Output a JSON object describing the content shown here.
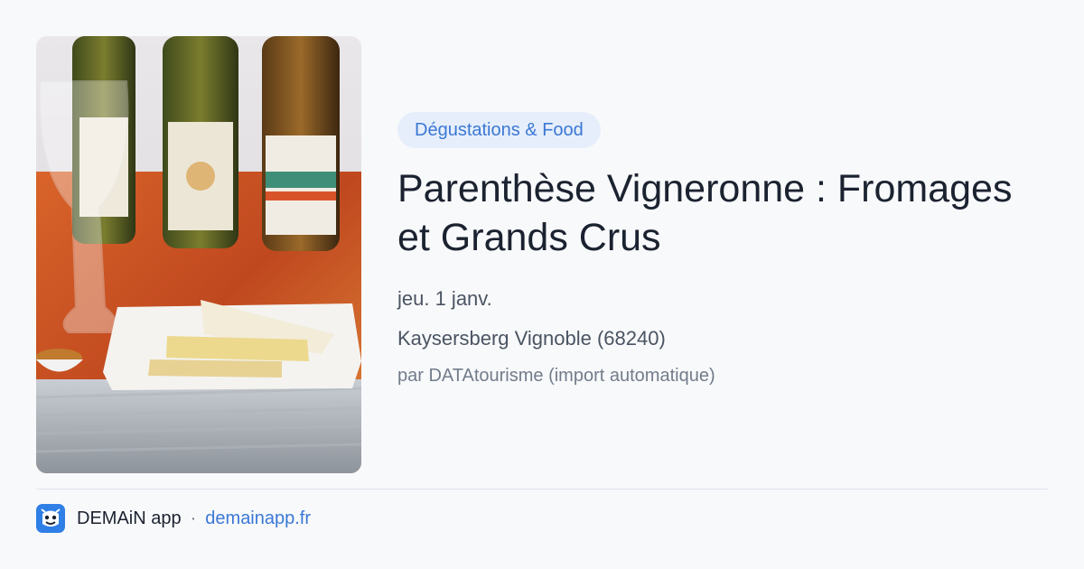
{
  "image": {
    "description_icon": "wine-cheese-photo"
  },
  "category": {
    "label": "Dégustations & Food"
  },
  "event": {
    "title": "Parenthèse Vigneronne : Fromages et Grands Crus",
    "date": "jeu. 1 janv.",
    "location": "Kaysersberg Vignoble (68240)",
    "source": "par DATAtourisme (import automatique)"
  },
  "footer": {
    "app_name": "DEMAiN app",
    "separator": "·",
    "url": "demainapp.fr",
    "logo_icon": "demain-app-logo-icon"
  },
  "colors": {
    "accent": "#3b78d4",
    "badge_bg": "#e6eefb",
    "title": "#1b2230",
    "text": "#4a5462",
    "muted": "#727c8a",
    "background": "#f8f9fb"
  }
}
